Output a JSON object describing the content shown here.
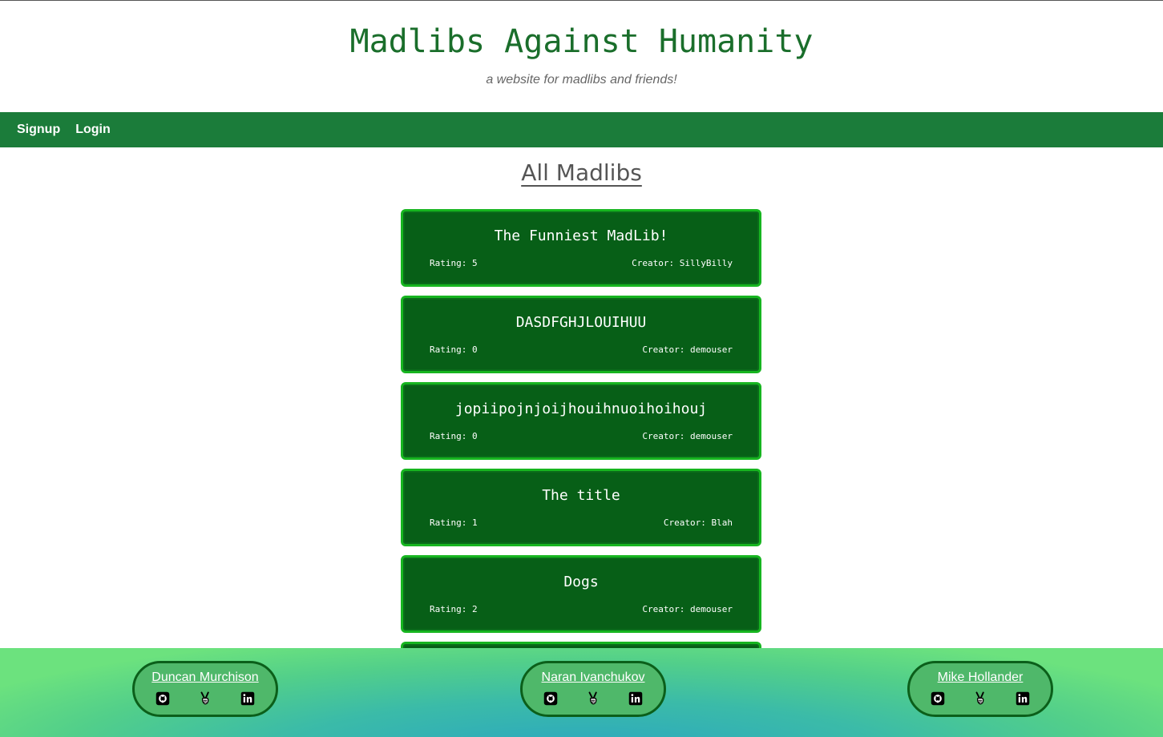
{
  "header": {
    "title": "Madlibs Against Humanity",
    "tagline": "a website for madlibs and friends!"
  },
  "nav": {
    "signup_label": "Signup",
    "login_label": "Login"
  },
  "main": {
    "section_title": "All Madlibs",
    "madlibs": [
      {
        "title": "The Funniest MadLib!",
        "rating": "Rating: 5",
        "creator": "Creator: SillyBilly"
      },
      {
        "title": "DASDFGHJLOUIHUU",
        "rating": "Rating: 0",
        "creator": "Creator: demouser"
      },
      {
        "title": "jopiipojnjoijhouihnuoihoihouj",
        "rating": "Rating: 0",
        "creator": "Creator: demouser"
      },
      {
        "title": "The title",
        "rating": "Rating: 1",
        "creator": "Creator: Blah"
      },
      {
        "title": "Dogs",
        "rating": "Rating: 2",
        "creator": "Creator: demouser"
      }
    ]
  },
  "footer": {
    "contributors": [
      {
        "name": "Duncan Murchison",
        "icons": [
          "github-icon",
          "peace-hand-icon",
          "linkedin-icon"
        ]
      },
      {
        "name": "Naran Ivanchukov",
        "icons": [
          "github-icon",
          "peace-hand-icon",
          "linkedin-icon"
        ]
      },
      {
        "name": "Mike Hollander",
        "icons": [
          "github-icon",
          "peace-hand-icon",
          "linkedin-icon"
        ]
      }
    ]
  },
  "colors": {
    "brand_green": "#1b7c3a",
    "card_bg": "#075f17",
    "card_border": "#17b520",
    "title_green": "#1a6e2b"
  }
}
